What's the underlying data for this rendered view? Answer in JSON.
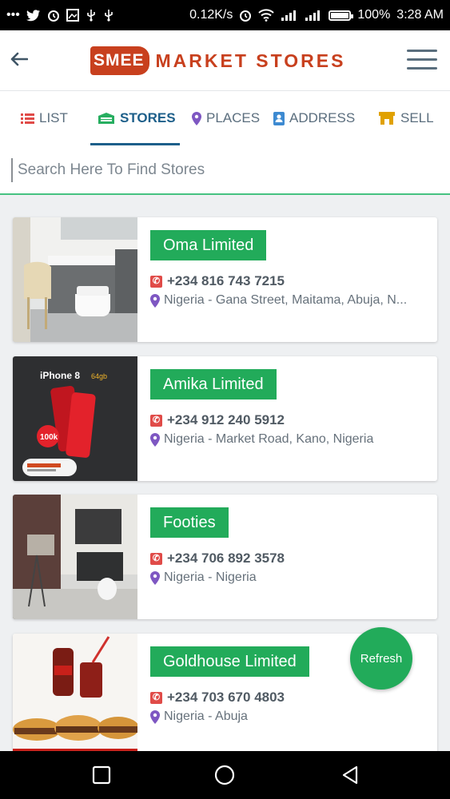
{
  "status_bar": {
    "left_icons": [
      "more-dots-icon",
      "twitter-icon",
      "alarm-icon",
      "image-icon",
      "usb-icon",
      "usb-icon"
    ],
    "speed": "0.12K/s",
    "battery": "100%",
    "battery_level": 1.0,
    "time": "3:28 AM"
  },
  "header": {
    "logo_badge": "SMEE",
    "logo_text": "MARKET STORES"
  },
  "tabs": [
    {
      "label": "LIST",
      "icon": "list-icon"
    },
    {
      "label": "STORES",
      "icon": "store-icon",
      "active": true
    },
    {
      "label": "PLACES",
      "icon": "map-pin-icon"
    },
    {
      "label": "ADDRESS",
      "icon": "address-card-icon"
    },
    {
      "label": "SELL",
      "icon": "shop-icon"
    }
  ],
  "search": {
    "placeholder": "Search Here To Find Stores",
    "value": ""
  },
  "stores": [
    {
      "name": "Oma Limited",
      "phone": "+234 816 743 7215",
      "address": "Nigeria - Gana Street, Maitama, Abuja, N..."
    },
    {
      "name": "Amika Limited",
      "phone": "+234 912 240 5912",
      "address": "Nigeria - Market Road, Kano, Nigeria",
      "image_text": {
        "title": "iPhone 8",
        "capacity": "64gb",
        "price": "100k"
      }
    },
    {
      "name": "Footies",
      "phone": "+234 706 892 3578",
      "address": "Nigeria - Nigeria"
    },
    {
      "name": "Goldhouse Limited",
      "phone": "+234 703 670 4803",
      "address": "Nigeria - Abuja"
    }
  ],
  "refresh_label": "Refresh",
  "colors": {
    "brand": "#c8401e",
    "accent_green": "#22ab5a",
    "tab_active": "#1d5f8a",
    "phone_icon": "#e04b48",
    "pin_icon": "#7e57c2"
  }
}
